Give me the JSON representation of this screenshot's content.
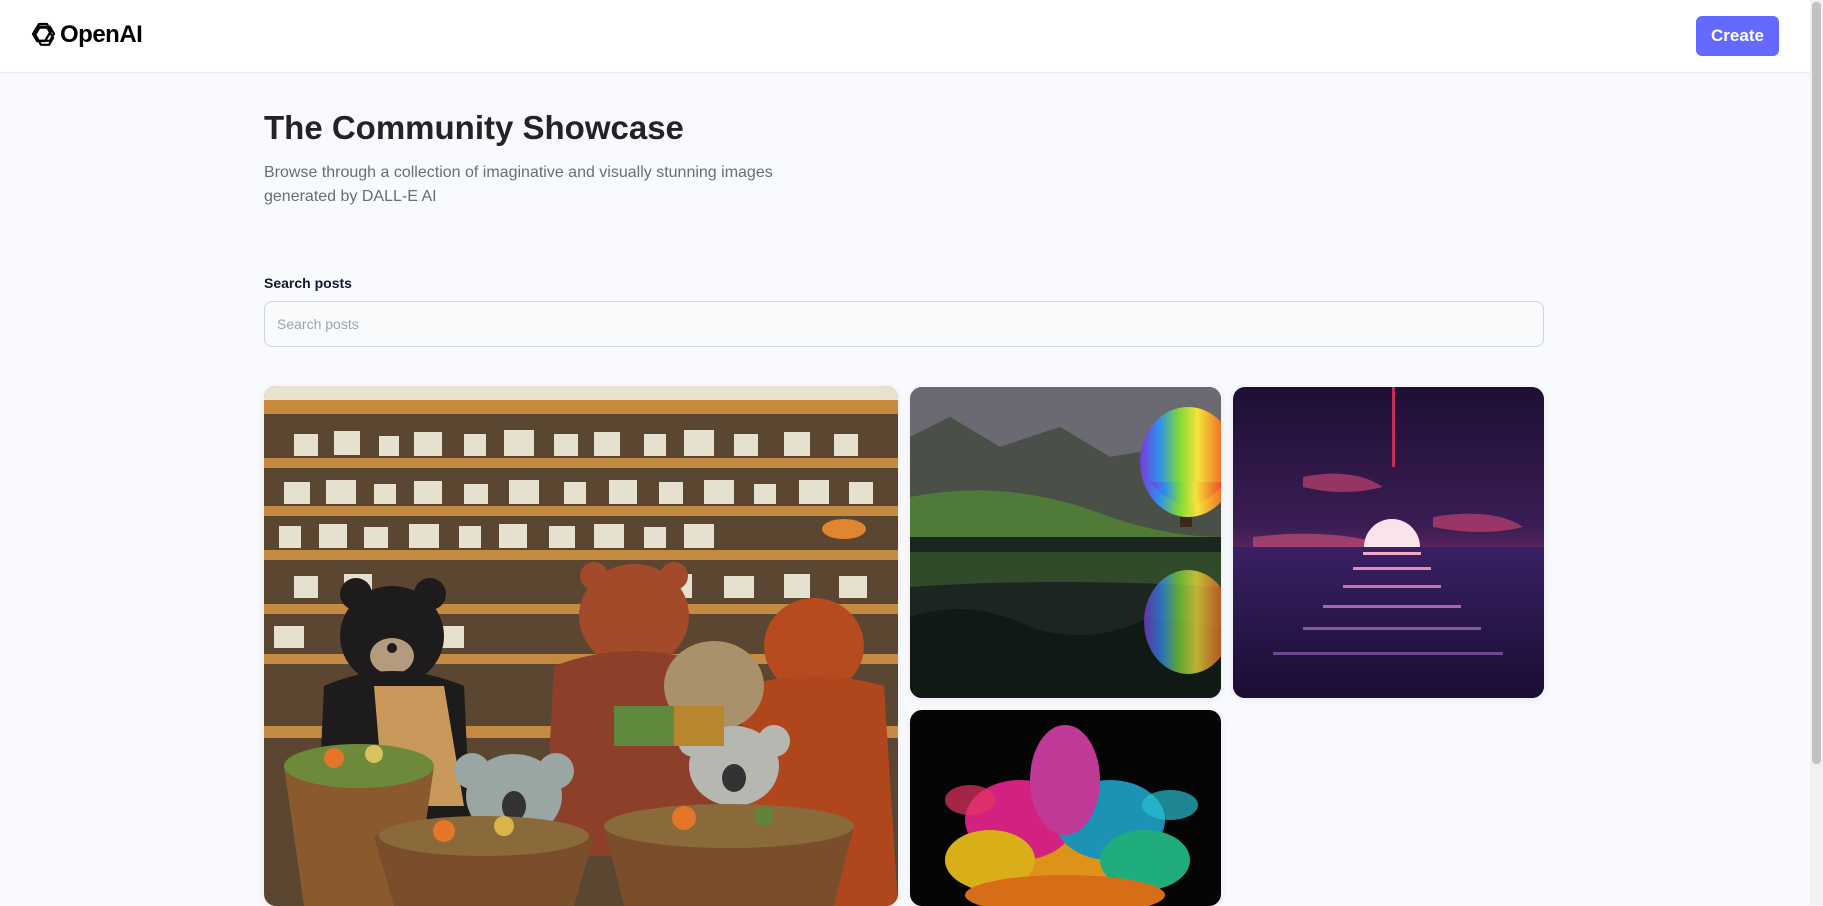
{
  "header": {
    "brand_name": "OpenAI",
    "brand_icon": "openai-logo-icon",
    "create_label": "Create",
    "accent_color": "#6469ff"
  },
  "showcase": {
    "title": "The Community Showcase",
    "subtitle": "Browse through a collection of imaginative and visually stunning images generated by DALL-E AI"
  },
  "search": {
    "label": "Search posts",
    "placeholder": "Search posts",
    "value": ""
  }
}
